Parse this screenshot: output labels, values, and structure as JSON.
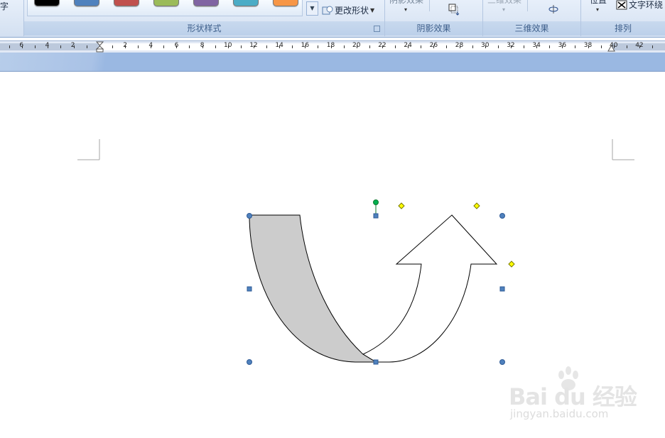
{
  "ribbon": {
    "partial_left_label": "字",
    "shape_styles": {
      "label": "形状样式",
      "change_shape": "更改形状",
      "swatches": [
        "#000000",
        "#4f81bd",
        "#c0504d",
        "#9bbb59",
        "#8064a2",
        "#4bacc6",
        "#f79646"
      ]
    },
    "shadow_effects": {
      "label": "阴影效果",
      "partial_button": "阴影效果"
    },
    "three_d_effects": {
      "label": "三维效果",
      "partial_button": "三维效果"
    },
    "arrange": {
      "label": "排列",
      "position_partial": "位置",
      "text_wrap": "文字环绕"
    }
  },
  "ruler": {
    "left_numbers": [
      "6",
      "4",
      "2"
    ],
    "right_numbers": [
      "2",
      "4",
      "6",
      "8",
      "10",
      "12",
      "14",
      "16",
      "18",
      "20",
      "22",
      "24",
      "26",
      "28",
      "30",
      "32",
      "34",
      "36",
      "38",
      "40",
      "42"
    ]
  },
  "colors": {
    "left_band_fill": "#cccccc",
    "arrow_fill": "#ffffff",
    "outline": "#000000",
    "handle_blue": "#4f81bd",
    "rotate_green": "#00b050",
    "adjust_yellow": "#ffff00"
  },
  "watermark": {
    "logo": "Bai  du 经验",
    "sub": "jingyan.baidu.com"
  }
}
